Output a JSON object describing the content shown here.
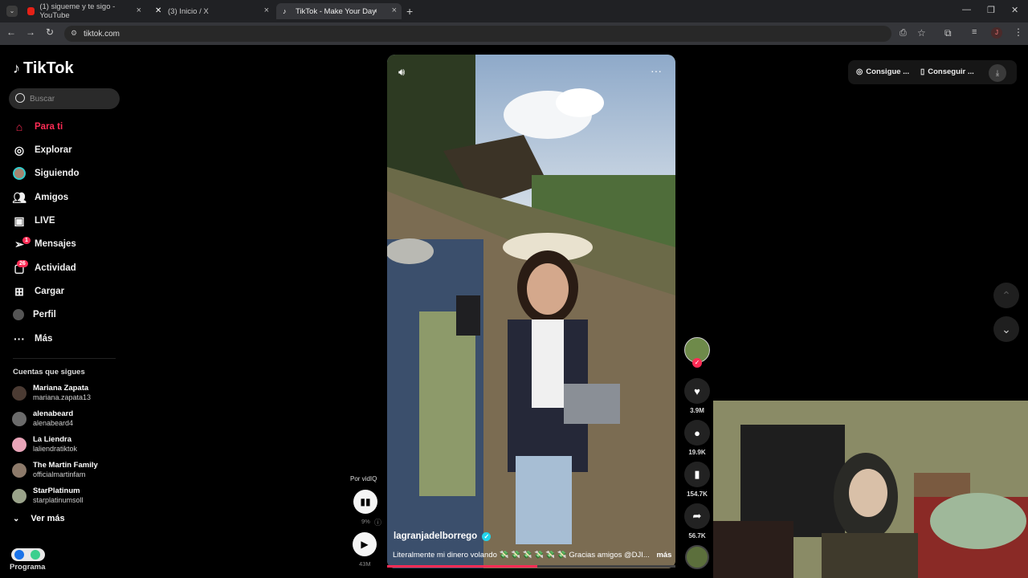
{
  "browser": {
    "tabs": [
      {
        "title": "(1) sigueme y te sigo - YouTube",
        "icon": "youtube-icon"
      },
      {
        "title": "(3) Inicio / X",
        "icon": "x-icon"
      },
      {
        "title": "TikTok - Make Your Day",
        "icon": "tiktok-icon"
      }
    ],
    "url": "tiktok.com",
    "profile_initial": "J"
  },
  "sidebar": {
    "logo": "TikTok",
    "search_placeholder": "Buscar",
    "nav": [
      {
        "label": "Para ti",
        "icon": "home-icon",
        "active": true
      },
      {
        "label": "Explorar",
        "icon": "compass-icon"
      },
      {
        "label": "Siguiendo",
        "icon": "following-avatar-icon"
      },
      {
        "label": "Amigos",
        "icon": "friends-icon"
      },
      {
        "label": "LIVE",
        "icon": "live-icon"
      },
      {
        "label": "Mensajes",
        "icon": "messages-icon",
        "badge": "1"
      },
      {
        "label": "Actividad",
        "icon": "activity-icon",
        "badge": "26"
      },
      {
        "label": "Cargar",
        "icon": "upload-icon"
      },
      {
        "label": "Perfil",
        "icon": "profile-icon"
      },
      {
        "label": "Más",
        "icon": "more-icon"
      }
    ],
    "following_title": "Cuentas que sigues",
    "following": [
      {
        "name": "Mariana Zapata",
        "handle": "mariana.zapata13"
      },
      {
        "name": "alenabeard",
        "handle": "alenabeard4"
      },
      {
        "name": "La Liendra",
        "handle": "laliendratiktok"
      },
      {
        "name": "The Martin Family",
        "handle": "officialmartinfam"
      },
      {
        "name": "StarPlatinum",
        "handle": "starplatinumsoll"
      }
    ],
    "see_more": "Ver más",
    "footer_label": "Programa"
  },
  "video": {
    "username": "lagranjadelborrego",
    "caption": "Literalmente mi dinero volando 💸 💸 💸 💸 💸 💸 Gracias amigos @DJI...",
    "caption_more": "más",
    "progress": 0.52
  },
  "actions": {
    "likes": "3.9M",
    "comments": "19.9K",
    "saves": "154.7K",
    "shares": "56.7K"
  },
  "vidiq": {
    "label": "Por vidIQ",
    "percent": "9%",
    "views": "43M"
  },
  "topbar": {
    "btn1": "Consigue ...",
    "btn2": "Conseguir ..."
  }
}
